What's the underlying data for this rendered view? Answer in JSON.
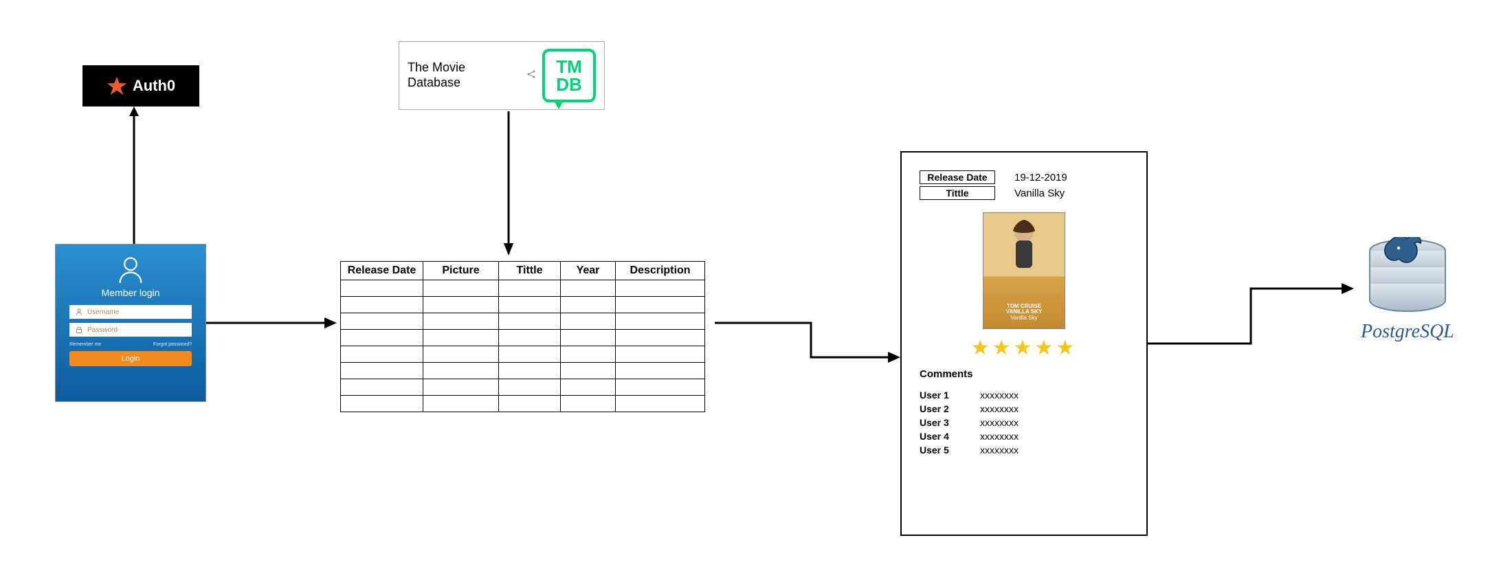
{
  "auth0": {
    "label": "Auth0"
  },
  "login": {
    "title": "Member login",
    "username_placeholder": "Username",
    "password_placeholder": "Password",
    "remember_label": "Remember me",
    "forgot_label": "Forgot password?",
    "button_label": "Login"
  },
  "tmdb": {
    "label": "The Movie Database",
    "logo_text": "TM\nDB"
  },
  "movie_table": {
    "columns": [
      "Release Date",
      "Picture",
      "Tittle",
      "Year",
      "Description"
    ],
    "empty_row_count": 8
  },
  "detail": {
    "fields": [
      {
        "label": "Release Date",
        "value": "19-12-2019"
      },
      {
        "label": "Tittle",
        "value": "Vanilla Sky"
      }
    ],
    "poster_actor_line": "TOM CRUISE",
    "poster_title_line": "VANILLA SKY",
    "poster_caption": "Vanilla Sky",
    "star_count": 5,
    "comments_heading": "Comments",
    "comments": [
      {
        "user": "User 1",
        "text": "xxxxxxxx"
      },
      {
        "user": "User 2",
        "text": "xxxxxxxx"
      },
      {
        "user": "User 3",
        "text": "xxxxxxxx"
      },
      {
        "user": "User 4",
        "text": "xxxxxxxx"
      },
      {
        "user": "User 5",
        "text": "xxxxxxxx"
      }
    ]
  },
  "database": {
    "label": "PostgreSQL"
  }
}
